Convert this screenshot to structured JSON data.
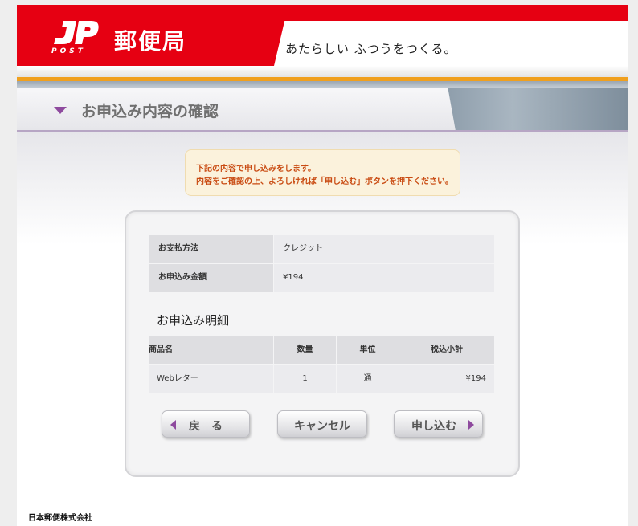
{
  "header": {
    "logo_post": "POST",
    "logo_text": "郵便局",
    "tagline": "あたらしい ふつうをつくる。"
  },
  "page_title": "お申込み内容の確認",
  "notice": {
    "line1": "下記の内容で申し込みをします。",
    "line2": "内容をご確認の上、よろしければ「申し込む」ボタンを押下ください。"
  },
  "payment": {
    "method_label": "お支払方法",
    "method_value": "クレジット",
    "amount_label": "お申込み金額",
    "amount_value": "¥194"
  },
  "details": {
    "heading": "お申込み明細",
    "columns": [
      "商品名",
      "数量",
      "単位",
      "税込小計"
    ],
    "rows": [
      {
        "name": "Webレター",
        "qty": "1",
        "unit": "通",
        "subtotal": "¥194"
      }
    ]
  },
  "buttons": {
    "back": "戻　る",
    "cancel": "キャンセル",
    "submit": "申し込む"
  },
  "footer": {
    "company": "日本郵便株式会社"
  },
  "colors": {
    "brand_red": "#e60012",
    "accent_purple": "#8e4a9e",
    "notice_text": "#c94b12"
  }
}
